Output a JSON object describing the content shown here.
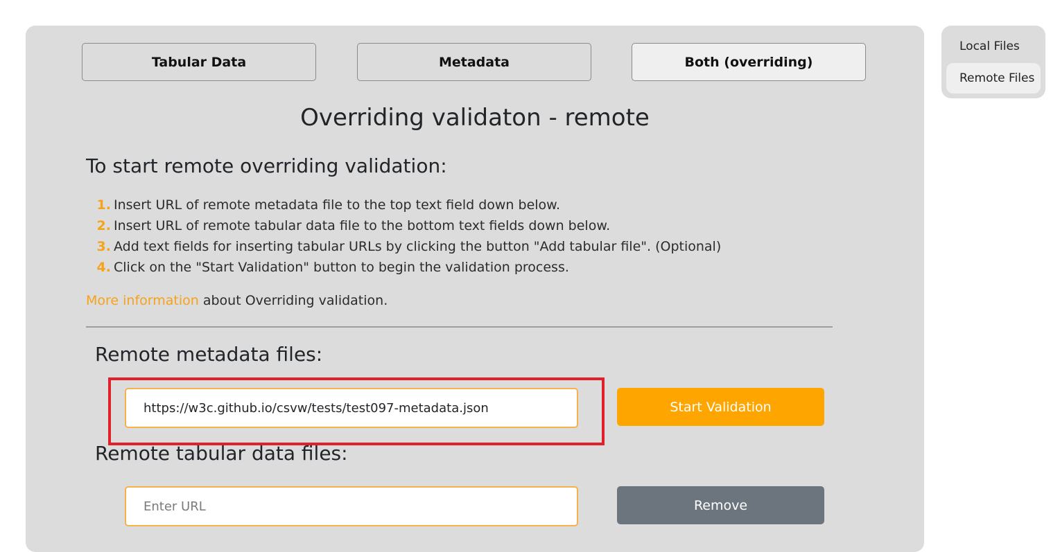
{
  "mode_tabs": {
    "tabular": "Tabular Data",
    "metadata": "Metadata",
    "both": "Both (overriding)"
  },
  "page_title": "Overriding validaton - remote",
  "instructions": {
    "heading": "To start remote overriding validation:",
    "steps": [
      {
        "num": "1.",
        "text": "Insert URL of remote metadata file to the top text field down below."
      },
      {
        "num": "2.",
        "text": "Insert URL of remote tabular data file to the bottom text fields down below."
      },
      {
        "num": "3.",
        "text": "Add text fields for inserting tabular URLs by clicking the button \"Add tabular file\". (Optional)"
      },
      {
        "num": "4.",
        "text": "Click on the \"Start Validation\" button to begin the validation process."
      }
    ]
  },
  "more_info": {
    "link_text": "More information",
    "rest_text": " about Overriding validation."
  },
  "metadata_section": {
    "heading": "Remote metadata files:",
    "input_value": "https://w3c.github.io/csvw/tests/test097-metadata.json",
    "start_button": "Start Validation"
  },
  "tabular_section": {
    "heading": "Remote tabular data files:",
    "input_placeholder": "Enter URL",
    "input_value": "",
    "remove_button": "Remove"
  },
  "side_nav": {
    "local": "Local Files",
    "remote": "Remote Files"
  },
  "colors": {
    "accent": "#ffa500",
    "link": "#f6a21a",
    "panel": "#dcdcdc",
    "highlight": "#e0202a",
    "remove": "#6c757d"
  }
}
